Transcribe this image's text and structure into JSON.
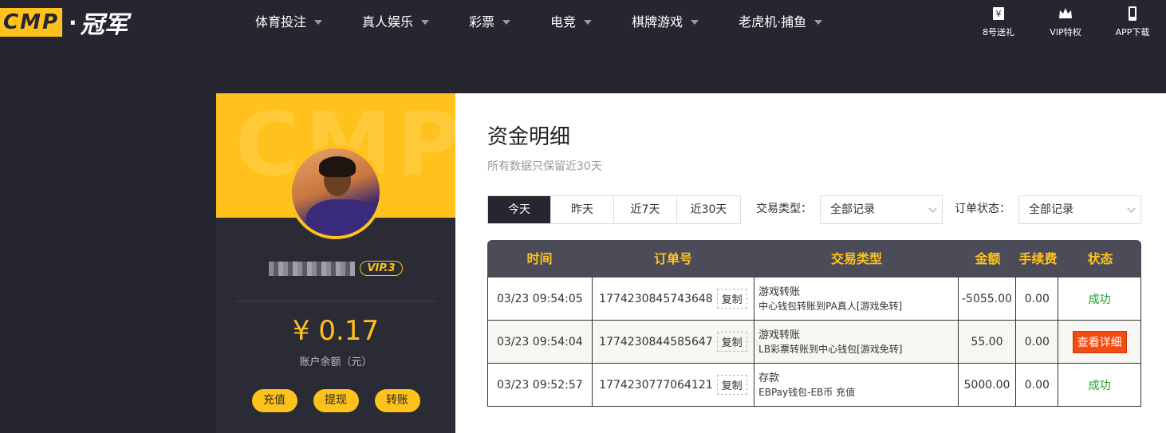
{
  "brand": {
    "logo_box": "CMP",
    "logo_sep": "·",
    "logo_cn": "冠军"
  },
  "nav": {
    "items": [
      "体育投注",
      "真人娱乐",
      "彩票",
      "电竞",
      "棋牌游戏",
      "老虎机·捕鱼"
    ],
    "tools": [
      {
        "label": "8号送礼",
        "icon": "gift-ticket-icon"
      },
      {
        "label": "VIP特权",
        "icon": "crown-icon"
      },
      {
        "label": "APP下载",
        "icon": "phone-icon"
      }
    ]
  },
  "profile": {
    "watermark": "CMP",
    "vip_label": "VIP.3",
    "balance": "¥ 0.17",
    "balance_label": "账户余额（元）",
    "actions": [
      "充值",
      "提现",
      "转账"
    ]
  },
  "main": {
    "title": "资金明细",
    "subtitle": "所有数据只保留近30天",
    "day_tabs": [
      "今天",
      "昨天",
      "近7天",
      "近30天"
    ],
    "active_tab": "今天",
    "filters": {
      "type_label": "交易类型：",
      "type_value": "全部记录",
      "status_label": "订单状态：",
      "status_value": "全部记录"
    },
    "table": {
      "headers": [
        "时间",
        "订单号",
        "交易类型",
        "金额",
        "手续费",
        "状态"
      ],
      "copy_label": "复制",
      "rows": [
        {
          "time": "03/23 09:54:05",
          "order": "1774230845743648",
          "type": "游戏转账",
          "type_detail": "中心钱包转账到PA真人[游戏免转]",
          "amount": "-5055.00",
          "fee": "0.00",
          "status": "成功",
          "status_kind": "text"
        },
        {
          "time": "03/23 09:54:04",
          "order": "1774230844585647",
          "type": "游戏转账",
          "type_detail": "LB彩票转账到中心钱包[游戏免转]",
          "amount": "55.00",
          "fee": "0.00",
          "status": "查看详细",
          "status_kind": "button"
        },
        {
          "time": "03/23 09:52:57",
          "order": "1774230777064121",
          "type": "存款",
          "type_detail": "EBPay钱包-EB币 充值",
          "amount": "5000.00",
          "fee": "0.00",
          "status": "成功",
          "status_kind": "text"
        }
      ]
    }
  }
}
